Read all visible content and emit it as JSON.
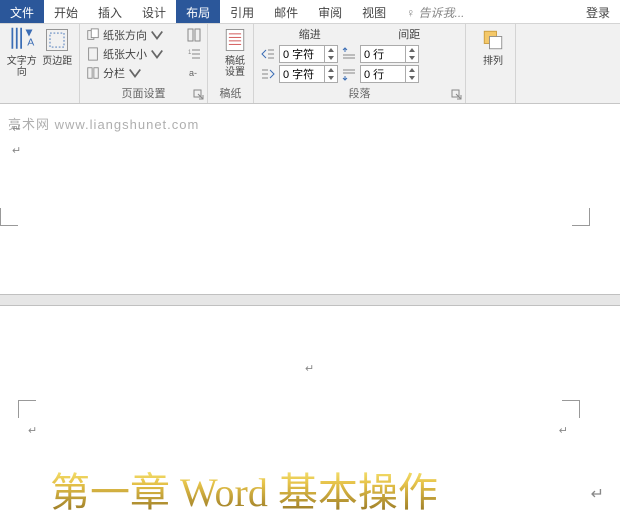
{
  "tabs": {
    "file": "文件",
    "home": "开始",
    "insert": "插入",
    "design": "设计",
    "layout": "布局",
    "references": "引用",
    "mailings": "邮件",
    "review": "审阅",
    "view": "视图",
    "tell_me": "告诉我...",
    "login": "登录"
  },
  "ribbon": {
    "page_setup": {
      "text_direction": "文字方向",
      "margins": "页边距",
      "orientation": "纸张方向",
      "size": "纸张大小",
      "columns": "分栏",
      "label": "页面设置"
    },
    "manuscript": {
      "btn": "稿纸\n设置",
      "label": "稿纸"
    },
    "paragraph": {
      "indent_header": "缩进",
      "spacing_header": "间距",
      "indent_left": "0 字符",
      "indent_right": "0 字符",
      "space_before": "0 行",
      "space_after": "0 行",
      "label": "段落"
    },
    "arrange": {
      "btn": "排列",
      "label": ""
    }
  },
  "document": {
    "watermark": "亮术网 www.liangshunet.com",
    "heading": "第一章 Word  基本操作",
    "para_mark": "↵"
  }
}
